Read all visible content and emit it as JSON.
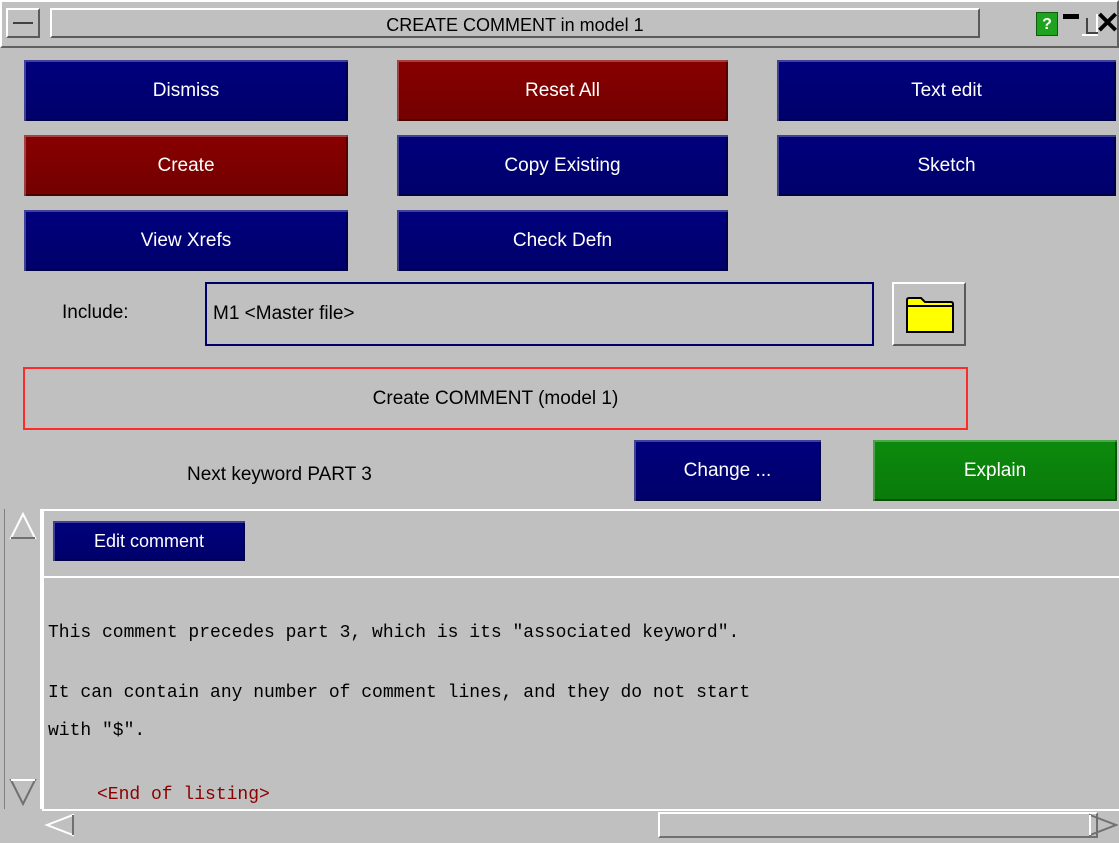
{
  "window": {
    "title": "CREATE COMMENT in model 1",
    "help_label": "?"
  },
  "buttons": {
    "dismiss": "Dismiss",
    "reset_all": "Reset All",
    "text_edit": "Text edit",
    "create": "Create",
    "copy_existing": "Copy Existing",
    "sketch": "Sketch",
    "view_xrefs": "View Xrefs",
    "check_defn": "Check Defn",
    "change": "Change ...",
    "explain": "Explain",
    "edit_comment": "Edit comment"
  },
  "include": {
    "label": "Include:",
    "value": "M1  <Master file>"
  },
  "create_banner": "Create COMMENT (model 1)",
  "next_keyword": "Next keyword PART 3",
  "listing": {
    "line1": "This comment precedes part 3, which is its \"associated keyword\".",
    "line2": "It can contain any number of comment lines, and they do not start",
    "line3": "with \"$\".",
    "end": "<End of listing>"
  },
  "colors": {
    "blue_button": "#00007d",
    "red_button": "#880000",
    "green_button": "#0c8a0c",
    "banner_border": "#ff2a2a",
    "end_listing": "#8b0000"
  },
  "icons": [
    "window-menu-icon",
    "help-icon",
    "minimize-icon",
    "maximize-icon",
    "close-icon",
    "folder-icon",
    "scroll-up-arrow-icon",
    "scroll-down-arrow-icon",
    "scroll-left-arrow-icon",
    "scroll-right-arrow-icon"
  ]
}
